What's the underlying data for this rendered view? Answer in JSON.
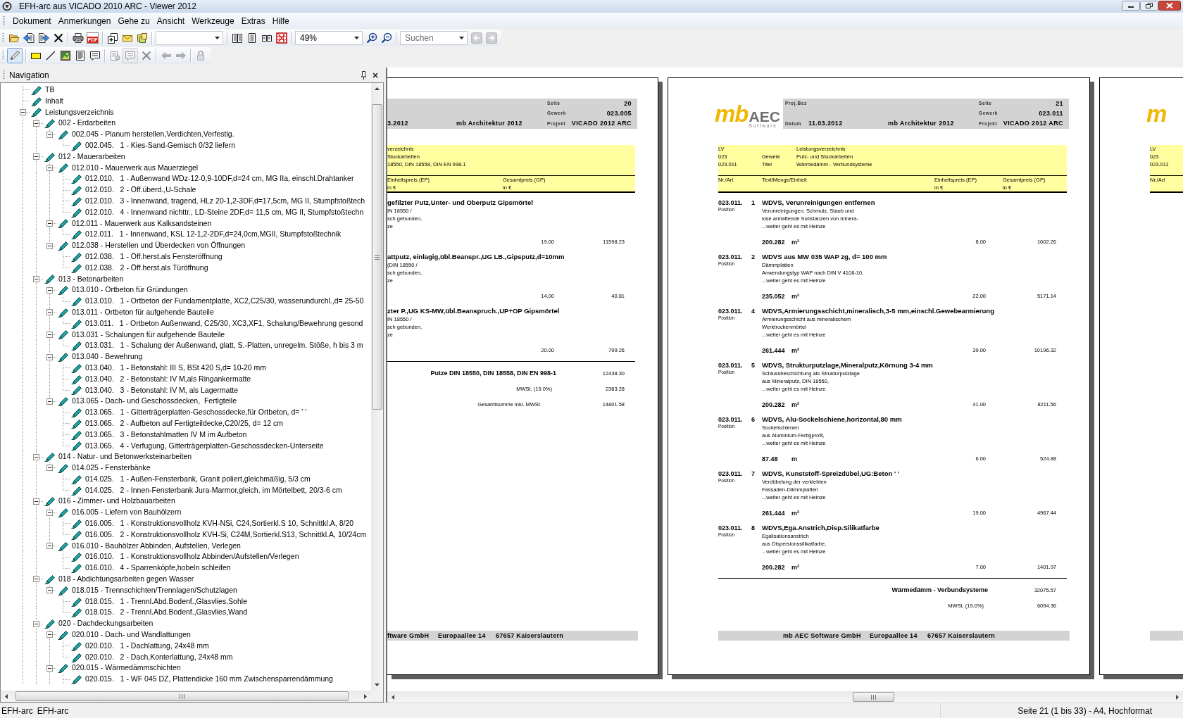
{
  "window": {
    "title": "EFH-arc aus VICADO 2010 ARC - Viewer 2012"
  },
  "menu": [
    "Dokument",
    "Anmerkungen",
    "Gehe zu",
    "Ansicht",
    "Werkzeuge",
    "Extras",
    "Hilfe"
  ],
  "toolbars": [
    {
      "groups": [
        [
          {
            "kind": "open-folder",
            "disabled": false
          },
          {
            "kind": "document-import",
            "disabled": false
          },
          {
            "kind": "document-export",
            "disabled": false
          },
          {
            "kind": "delete",
            "disabled": false
          }
        ],
        [
          {
            "kind": "print",
            "disabled": false
          },
          {
            "kind": "pdf",
            "label": "PDF",
            "disabled": false
          }
        ],
        [
          {
            "kind": "copy-pages",
            "disabled": false
          },
          {
            "kind": "mail",
            "disabled": false
          },
          {
            "kind": "documents",
            "disabled": false
          }
        ],
        [
          {
            "kind": "combo",
            "disabled": false
          }
        ],
        [
          {
            "kind": "book-view",
            "disabled": false
          },
          {
            "kind": "page-view",
            "disabled": false
          },
          {
            "kind": "two-page-view",
            "disabled": false
          },
          {
            "kind": "grid-view",
            "disabled": false
          }
        ],
        [
          {
            "kind": "combo",
            "value": "49%",
            "disabled": false
          },
          {
            "kind": "zoom-in",
            "disabled": false
          },
          {
            "kind": "zoom-out",
            "disabled": false
          }
        ],
        [
          {
            "kind": "search",
            "placeholder": "Suchen",
            "disabled": false
          },
          {
            "kind": "back",
            "disabled": true
          },
          {
            "kind": "forward",
            "disabled": true
          }
        ]
      ]
    },
    {
      "groups": [
        [
          {
            "kind": "pencil",
            "disabled": false,
            "pressed": true
          }
        ],
        [
          {
            "kind": "rectangle",
            "disabled": false,
            "pressed": false
          },
          {
            "kind": "line",
            "disabled": false,
            "pressed": false
          },
          {
            "kind": "image",
            "disabled": false,
            "pressed": false
          },
          {
            "kind": "text",
            "disabled": false,
            "pressed": false
          },
          {
            "kind": "comment",
            "disabled": false,
            "pressed": false
          }
        ],
        [
          {
            "kind": "properties",
            "disabled": true,
            "pressed": false
          },
          {
            "kind": "comment",
            "disabled": true,
            "pressed": true
          },
          {
            "kind": "delete",
            "disabled": true,
            "pressed": false
          }
        ],
        [
          {
            "kind": "arrow-left",
            "disabled": true,
            "pressed": false
          },
          {
            "kind": "arrow-right",
            "disabled": true,
            "pressed": false
          }
        ],
        [
          {
            "kind": "lock",
            "disabled": true,
            "pressed": false
          }
        ]
      ]
    }
  ],
  "navigation": {
    "title": "Navigation",
    "tree": [
      {
        "label": "TB"
      },
      {
        "label": "Inhalt"
      },
      {
        "label": "Leistungsverzeichnis",
        "expanded": true,
        "children": [
          {
            "label": "002 - Erdarbeiten",
            "expanded": true,
            "children": [
              {
                "label": "002.045 - Planum herstellen,Verdichten,Verfestig.",
                "expanded": true,
                "children": [
                  {
                    "label": "002.045.   1 - Kies-Sand-Gemisch 0/32 liefern"
                  }
                ]
              }
            ]
          },
          {
            "label": "012 - Mauerarbeiten",
            "expanded": true,
            "children": [
              {
                "label": "012.010 - Mauerwerk aus Mauerziegel",
                "expanded": true,
                "children": [
                  {
                    "label": "012.010.   1 - Außenwand WDz-12-0,9-10DF,d=24 cm, MG IIa, einschl.Drahtanker"
                  },
                  {
                    "label": "012.010.   2 - Öff.überd.,U-Schale"
                  },
                  {
                    "label": "012.010.   3 - Innenwand, tragend, HLz 20-1,2-3DF,d=17,5cm, MG II, Stumpfstoßtech"
                  },
                  {
                    "label": "012.010.   4 - Innenwand nichttr., LD-Steine 2DF,d= 11,5 cm, MG II, Stumpfstoßtechn"
                  }
                ]
              },
              {
                "label": "012.011 - Mauerwerk aus Kalksandsteinen",
                "expanded": true,
                "children": [
                  {
                    "label": "012.011.   1 - Innenwand, KSL 12-1,2-2DF,d=24,0cm,MGII, Stumpfstoßtechnik"
                  }
                ]
              },
              {
                "label": "012.038 - Herstellen und Überdecken von Öffnungen",
                "expanded": true,
                "children": [
                  {
                    "label": "012.038.   1 - Öff.herst.als Fensteröffnung"
                  },
                  {
                    "label": "012.038.   2 - Öff.herst.als Türöffnung"
                  }
                ]
              }
            ]
          },
          {
            "label": "013 - Betonarbeiten",
            "expanded": true,
            "children": [
              {
                "label": "013.010 - Ortbeton für Gründungen",
                "expanded": true,
                "children": [
                  {
                    "label": "013.010.   1 - Ortbeton der Fundamentplatte, XC2,C25/30, wasserundurchl.,d= 25-50"
                  }
                ]
              },
              {
                "label": "013.011 - Ortbeton für aufgehende Bauteile",
                "expanded": true,
                "children": [
                  {
                    "label": "013.011.   1 - Ortbeton Außenwand, C25/30, XC3,XF1, Schalung/Bewehrung gesond"
                  }
                ]
              },
              {
                "label": "013.031 - Schalungen für aufgehende Bauteile",
                "expanded": true,
                "children": [
                  {
                    "label": "013.031.   1 - Schalung der Außenwand, glatt, S.-Platten, unregelm. Stöße, h bis 3 m"
                  }
                ]
              },
              {
                "label": "013.040 - Bewehrung",
                "expanded": true,
                "children": [
                  {
                    "label": "013.040.   1 - Betonstahl: III S, BSt 420 S,d= 10-20 mm"
                  },
                  {
                    "label": "013.040.   2 - Betonstahl: IV M,als Ringankermatte"
                  },
                  {
                    "label": "013.040.   3 - Betonstahl: IV M, als Lagermatte"
                  }
                ]
              },
              {
                "label": "013.065 - Dach- und Geschossdecken,  Fertigteile",
                "expanded": true,
                "children": [
                  {
                    "label": "013.065.   1 - Gitterträgerplatten-Geschossdecke,für Ortbeton, d= ' '"
                  },
                  {
                    "label": "013.065.   2 - Aufbeton auf Fertigteildecke,C20/25, d= 12 cm"
                  },
                  {
                    "label": "013.065.   3 - Betonstahlmatten IV M im Aufbeton"
                  },
                  {
                    "label": "013.065.   4 - Verfugung, Gitterträgerplatten-Geschossdecken-Unterseite"
                  }
                ]
              }
            ]
          },
          {
            "label": "014 - Natur- und Betonwerksteinarbeiten",
            "expanded": true,
            "children": [
              {
                "label": "014.025 - Fensterbänke",
                "expanded": true,
                "children": [
                  {
                    "label": "014.025.   1 - Außen-Fensterbank, Granit poliert,gleichmäßig, 5/3 cm"
                  },
                  {
                    "label": "014.025.   2 - Innen-Fensterbank Jura-Marmor,gleich. im Mörtelbett, 20/3-6 cm"
                  }
                ]
              }
            ]
          },
          {
            "label": "016 - Zimmer- und Holzbauarbeiten",
            "expanded": true,
            "children": [
              {
                "label": "016.005 - Liefern von Bauhölzern",
                "expanded": true,
                "children": [
                  {
                    "label": "016.005.   1 - Konstruktionsvollholz KVH-NSi, C24,Sortierkl.S 10, Schnittkl.A, 8/20"
                  },
                  {
                    "label": "016.005.   2 - Konstruktionsvollholz KVH-Si, C24M,Sortierkl.S13, Schnittkl.A, 10/24cm"
                  }
                ]
              },
              {
                "label": "016.010 - Bauhölzer Abbinden, Aufstellen, Verlegen",
                "expanded": true,
                "children": [
                  {
                    "label": "016.010.   1 - Konstruktionsvollholz Abbinden/Aufstellen/Verlegen"
                  },
                  {
                    "label": "016.010.   4 - Sparrenköpfe,hobeln schleifen"
                  }
                ]
              }
            ]
          },
          {
            "label": "018 - Abdichtungsarbeiten gegen Wasser",
            "expanded": true,
            "children": [
              {
                "label": "018.015 - Trennschichten/Trennlagen/Schutzlagen",
                "expanded": true,
                "children": [
                  {
                    "label": "018.015.   1 - Trennl.Abd.Bodenf.,Glasvlies,Sohle"
                  },
                  {
                    "label": "018.015.   2 - Trennl.Abd.Bodenf.,Glasvlies,Wand"
                  }
                ]
              }
            ]
          },
          {
            "label": "020 - Dachdeckungsarbeiten",
            "expanded": true,
            "children": [
              {
                "label": "020.010 - Dach- und Wandlattungen",
                "expanded": true,
                "children": [
                  {
                    "label": "020.010.   1 - Dachlattung, 24x48 mm"
                  },
                  {
                    "label": "020.010.   2 - Dach,Konterlattung, 24x48 mm"
                  }
                ]
              },
              {
                "label": "020.015 - Wärmedämmschichten",
                "expanded": true,
                "children": [
                  {
                    "label": "020.015.   1 - WF 045 DZ, Plattendicke 160 mm Zwischensparrendämmung"
                  }
                ]
              }
            ]
          }
        ]
      }
    ]
  },
  "document": {
    "pages": [
      {
        "kind": "clipped-left",
        "header": {
          "date": "3.2012",
          "program": "mb Architektur 2012",
          "fields": [
            {
              "label": "Seite",
              "value": "20"
            },
            {
              "label": "Gewerk",
              "value": "023.005"
            },
            {
              "label": "Projekt",
              "value": "VICADO 2012 ARC"
            }
          ]
        },
        "info": [
          {
            "text": "verzeichnis"
          },
          {
            "text": "Stuckarbeiten"
          },
          {
            "text": "18550, DIN 18558, DIN EN 998-1"
          }
        ],
        "columns": [
          {
            "kind": "price",
            "label": "Einheitspreis (EP)",
            "unit": "in €"
          },
          {
            "kind": "total",
            "label": "Gesamtpreis (GP)",
            "unit": "in €"
          }
        ],
        "positions": [
          {
            "title": "gefilzter Putz,Unter- und Oberputz Gipsmörtel",
            "text": [
              "IN 18550 /",
              "sch gebunden,",
              "ze"
            ],
            "unit_price": "19.00",
            "total": "11598.23"
          },
          {
            "title": "attputz, einlagig,übl.Beanspr.,UG LB.,Gipsputz,d=10mm",
            "text": [
              "(DIN 18550 /",
              "sch gebunden,",
              "ze"
            ],
            "unit_price": "14.00",
            "total": "40.81"
          },
          {
            "title": "zter P.,UG KS-MW,übl.Beanspruch.,UP+OP Gipsmörtel",
            "text": [
              "IN 18550 /",
              "sch gebunden,",
              "ze"
            ],
            "unit_price": "20.00",
            "total": "799.26"
          }
        ],
        "totals": [
          {
            "kind": "subtotal",
            "label": "Putze DIN 18550, DIN 18558, DIN EN 998-1",
            "value": "12438.30"
          },
          {
            "kind": "tax",
            "label": "MWSt. (19.0%)",
            "value": "2363.28"
          },
          {
            "kind": "total",
            "label": "Gesamtsumme inkl. MWSt.",
            "value": "14801.58"
          }
        ],
        "footer": [
          "ftware GmbH",
          "Europaallee 14",
          "67657 Kaiserslautern"
        ]
      },
      {
        "kind": "full",
        "logo": {
          "mark": "mb",
          "letters": "AEC",
          "tagline": "Software"
        },
        "header": {
          "project_label": "Proj.Bez",
          "date_label": "Datum",
          "date": "11.03.2012",
          "program": "mb Architektur 2012",
          "fields": [
            {
              "label": "Seite",
              "value": "21"
            },
            {
              "label": "Gewerk",
              "value": "023.011"
            },
            {
              "label": "Projekt",
              "value": "VICADO 2012 ARC"
            }
          ]
        },
        "info": [
          {
            "code": "LV",
            "text": "Leistungsverzeichnis"
          },
          {
            "code": "023",
            "label": "Gewerk",
            "text": "Putz- und Stuckarbeiten"
          },
          {
            "code": "023.011",
            "label": "Titel",
            "text": "Wärmedämm - Verbundsysteme"
          }
        ],
        "columns": [
          {
            "kind": "number",
            "label": "Nr./Art"
          },
          {
            "kind": "text",
            "label": "Text/Menge/Einheit"
          },
          {
            "kind": "price",
            "label": "Einheitspreis (EP)",
            "unit": "in €"
          },
          {
            "kind": "total",
            "label": "Gesamtpreis (GP)",
            "unit": "in €"
          }
        ],
        "positions": [
          {
            "number": "023.011.",
            "index": "1",
            "type_label": "Position",
            "title": "WDVS, Verunreinigungen entfernen",
            "text": [
              "Verunreinigungen, Schmutz, Staub und",
              "lose anhaftende Substanzen von minera-",
              "...weiter geht es mit Heinze"
            ],
            "quantity": "200.282",
            "unit": "m²",
            "unit_price": "8.00",
            "total": "1602.26"
          },
          {
            "number": "023.011.",
            "index": "2",
            "type_label": "Position",
            "title": "WDVS aus MW 035 WAP zg, d= 100 mm",
            "text": [
              "Dämmplatten",
              "Anwendungstyp WAP nach DIN V 4108-10,",
              "...weiter geht es mit Heinze"
            ],
            "quantity": "235.052",
            "unit": "m²",
            "unit_price": "22.00",
            "total": "5171.14"
          },
          {
            "number": "023.011.",
            "index": "4",
            "type_label": "Position",
            "title": "WDVS,Armierungsschicht,mineralisch,3-5 mm,einschl.Gewebearmierung",
            "text": [
              "Armierungsschicht aus mineralischem",
              "Werktrockenmörtel",
              "...weiter geht es mit Heinze"
            ],
            "quantity": "261.444",
            "unit": "m²",
            "unit_price": "39.00",
            "total": "10196.32"
          },
          {
            "number": "023.011.",
            "index": "5",
            "type_label": "Position",
            "title": "WDVS, Strukturputzlage,Mineralputz,Körnung 3-4 mm",
            "text": [
              "Schlussbeschichtung als Strukturputzlage",
              "aus Mineralputz, DIN 18550,",
              "...weiter geht es mit Heinze"
            ],
            "quantity": "200.282",
            "unit": "m²",
            "unit_price": "41.00",
            "total": "8211.56"
          },
          {
            "number": "023.011.",
            "index": "6",
            "type_label": "Position",
            "title": "WDVS, Alu-Sockelschiene,horizontal,80 mm",
            "text": [
              "Sockelschienen",
              "aus Aluminium-Fertigprofil,",
              "...weiter geht es mit Heinze"
            ],
            "quantity": "87.48",
            "unit": "m",
            "unit_price": "6.00",
            "total": "524.88"
          },
          {
            "number": "023.011.",
            "index": "7",
            "type_label": "Position",
            "title": "WDVS, Kunststoff-Spreizdübel,UG:Beton ' '",
            "text": [
              "Verdübelung der verklebten",
              "Fassaden-Dämmplatten",
              "...weiter geht es mit Heinze"
            ],
            "quantity": "261.444",
            "unit": "m²",
            "unit_price": "19.00",
            "total": "4967.44"
          },
          {
            "number": "023.011.",
            "index": "8",
            "type_label": "Position",
            "title": "WDVS,Ega.Anstrich,Disp.Silikatfarbe",
            "text": [
              "Egalisationsanstrich",
              "aus Dispersionssilikatfarbe,",
              "...weiter geht es mit Heinze"
            ],
            "quantity": "200.282",
            "unit": "m²",
            "unit_price": "7.00",
            "total": "1401.97"
          }
        ],
        "totals": [
          {
            "kind": "subtotal",
            "label": "Wärmedämm - Verbundsysteme",
            "value": "32075.57"
          },
          {
            "kind": "tax",
            "label": "MWSt. (19.0%)",
            "value": "6094.36"
          }
        ],
        "footer": [
          "mb AEC Software GmbH",
          "Europaallee 14",
          "67657 Kaiserslautern"
        ]
      },
      {
        "kind": "clipped-right",
        "logo": {
          "mark": "m"
        },
        "info": [
          {
            "code": "LV"
          },
          {
            "code": "023"
          },
          {
            "code": "023.011"
          }
        ],
        "columns": [
          {
            "kind": "number",
            "label": "Nr./Art"
          }
        ]
      }
    ]
  },
  "status_bar": {
    "items": [
      "EFH-arc",
      "EFH-arc"
    ],
    "page_info": "Seite 21 (1 bis 33) - A4, Hochformat"
  }
}
